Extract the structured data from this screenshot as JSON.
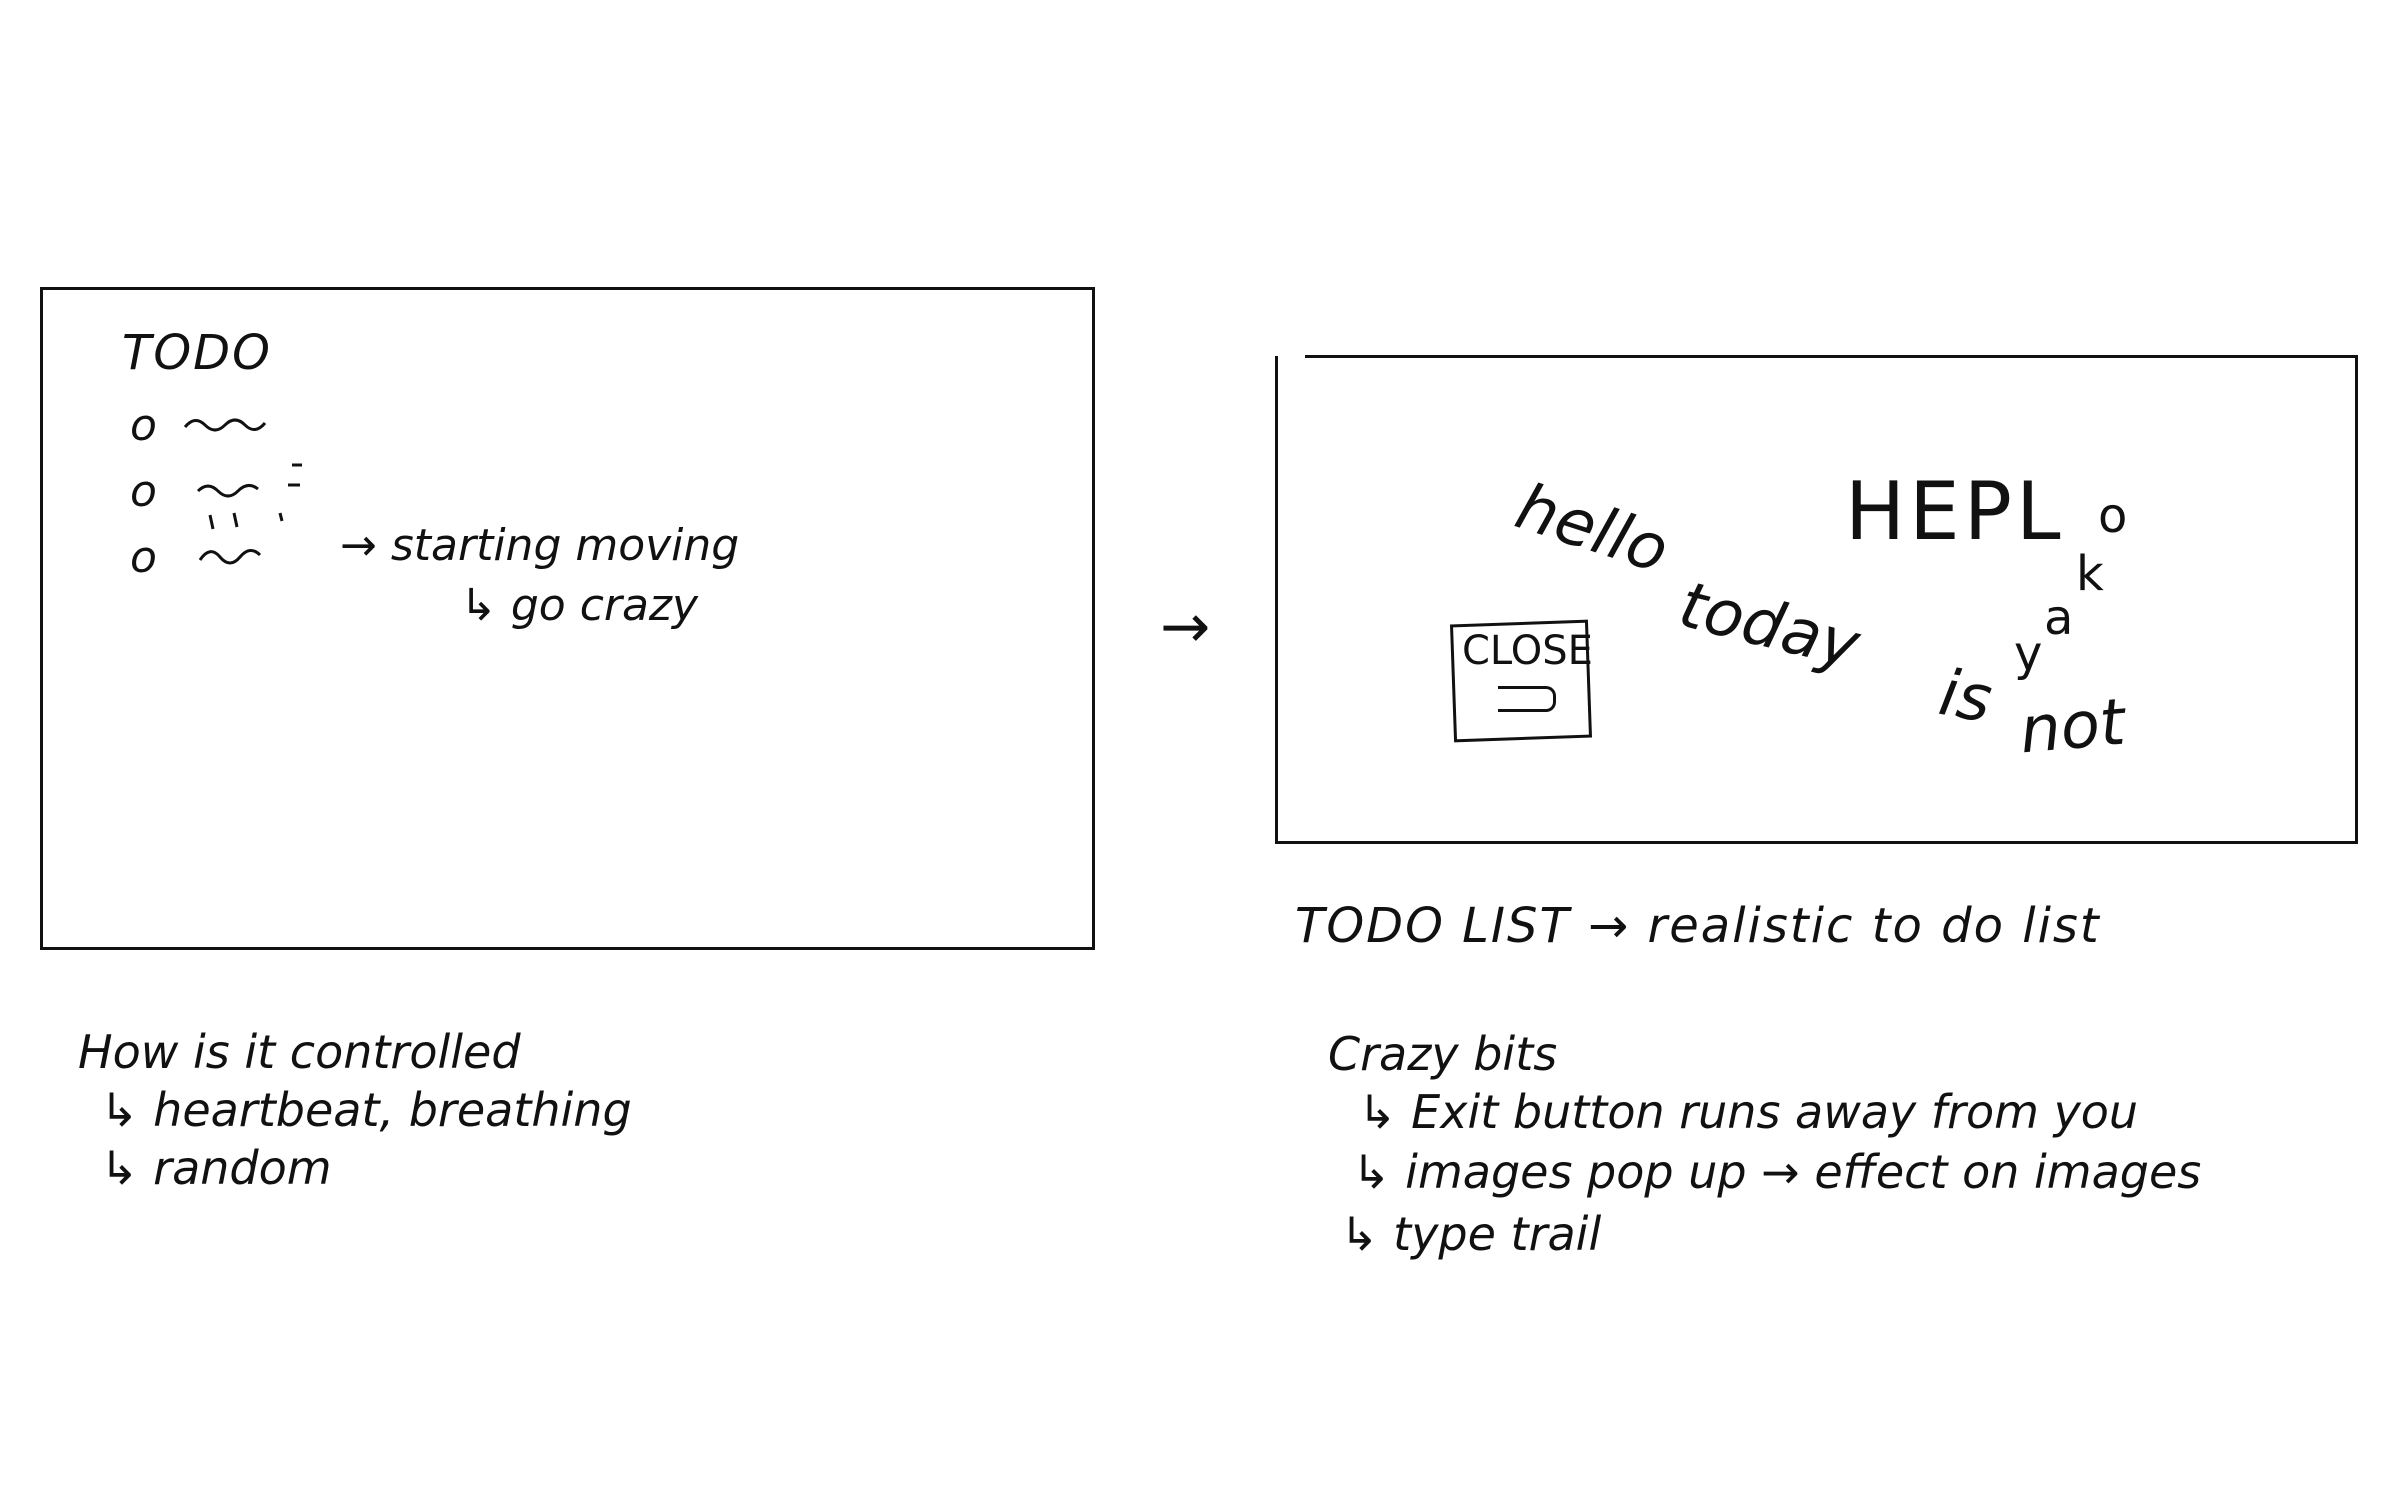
{
  "left_sketch": {
    "title": "TODO",
    "bullets": [
      "o",
      "o",
      "o"
    ],
    "annotation": "→ starting moving",
    "annotation_sub": "↳ go crazy"
  },
  "between_arrow": "→",
  "right_sketch": {
    "words": {
      "hello": "hello",
      "today": "today",
      "is": "is",
      "not": "not",
      "help": "HEPL"
    },
    "okay_letters": [
      "o",
      "k",
      "a",
      "y"
    ],
    "close_label": "CLOSE"
  },
  "caption": "TODO LIST  → realistic  to do list",
  "notes_left": {
    "heading": "How is it controlled",
    "items": [
      "↳ heartbeat, breathing",
      "↳ random"
    ]
  },
  "notes_right": {
    "heading": "Crazy bits",
    "items": [
      "↳ Exit button runs away from you",
      "↳ images pop up → effect on images",
      "↳ type trail"
    ]
  }
}
